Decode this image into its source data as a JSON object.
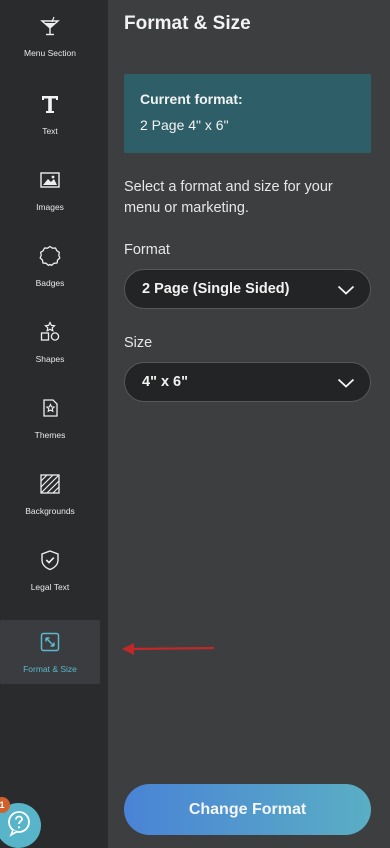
{
  "sidebar": {
    "items": [
      {
        "label": "Menu Section",
        "icon": "cocktail-glass-icon"
      },
      {
        "label": "Text",
        "icon": "text-t-icon"
      },
      {
        "label": "Images",
        "icon": "image-icon"
      },
      {
        "label": "Badges",
        "icon": "badge-icon"
      },
      {
        "label": "Shapes",
        "icon": "shapes-icon"
      },
      {
        "label": "Themes",
        "icon": "theme-star-icon"
      },
      {
        "label": "Backgrounds",
        "icon": "hatched-square-icon"
      },
      {
        "label": "Legal Text",
        "icon": "shield-check-icon"
      },
      {
        "label": "Format & Size",
        "icon": "resize-arrows-icon",
        "active": true
      }
    ]
  },
  "panel": {
    "title": "Format & Size",
    "current_format_heading": "Current format:",
    "current_format_value": "2 Page 4\" x 6\"",
    "description": "Select a format and size for your menu or marketing.",
    "format_label": "Format",
    "format_value": "2 Page (Single Sided)",
    "size_label": "Size",
    "size_value": "4\" x 6\"",
    "change_button": "Change Format"
  },
  "help": {
    "badge_count": "1"
  },
  "colors": {
    "sidebar_bg": "#2a2b2d",
    "panel_bg": "#3d3e40",
    "current_box_bg": "#2e5f68",
    "active_accent": "#5cb8cc",
    "annotation_arrow": "#c0282a"
  }
}
